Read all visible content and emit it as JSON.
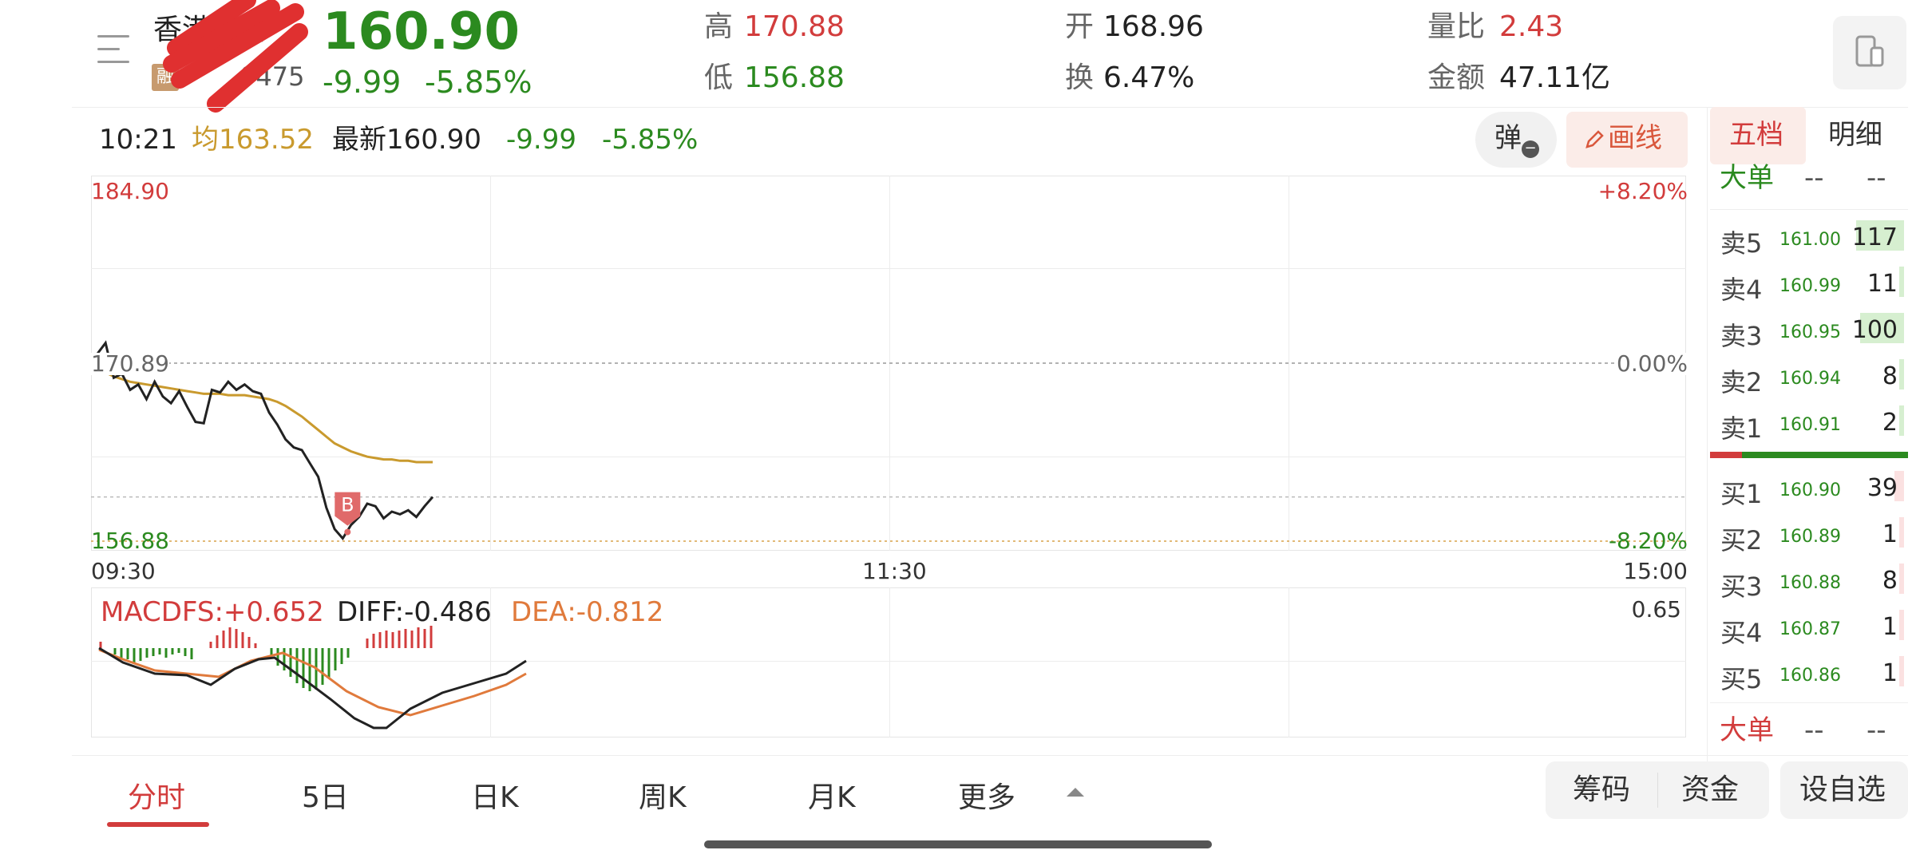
{
  "header": {
    "stock_name": "香港芯智",
    "stock_code": "0475",
    "rong_badge": "融",
    "price": "160.90",
    "change": "-9.99",
    "change_pct": "-5.85%",
    "high_label": "高",
    "high_value": "170.88",
    "low_label": "低",
    "low_value": "156.88",
    "open_label": "开",
    "open_value": "168.96",
    "turnover_label": "换",
    "turnover_value": "6.47%",
    "vol_ratio_label": "量比",
    "vol_ratio_value": "2.43",
    "amount_label": "金额",
    "amount_value": "47.11亿"
  },
  "infobar": {
    "time": "10:21",
    "avg_label": "均163.52",
    "latest_label": "最新160.90",
    "change": "-9.99",
    "change_pct": "-5.85%",
    "popup_button": "弹",
    "draw_button": "画线"
  },
  "chart": {
    "y_top": "184.90",
    "y_mid": "170.89",
    "y_bottom": "156.88",
    "pct_top": "+8.20%",
    "pct_mid": "0.00%",
    "pct_bottom": "-8.20%",
    "time_start": "09:30",
    "time_mid": "11:30",
    "time_end": "15:00",
    "marker": "B"
  },
  "chart_data": {
    "type": "line",
    "x_axis": [
      "09:30",
      "11:30",
      "15:00"
    ],
    "ylim": [
      156.88,
      184.9
    ],
    "prev_close": 170.89,
    "series": [
      {
        "name": "最新",
        "values": [
          171.6,
          172.4,
          169.8,
          170.1,
          168.9,
          169.3,
          168.2,
          169.5,
          168.4,
          167.9,
          168.8,
          167.6,
          166.5,
          166.4,
          168.9,
          168.7,
          169.5,
          168.9,
          169.3,
          168.8,
          168.6,
          167.2,
          166.3,
          165.2,
          164.6,
          164.4,
          163.4,
          162.4,
          160.1,
          158.5,
          157.8,
          158.8,
          159.4,
          160.4,
          160.2,
          159.3,
          159.8,
          159.6,
          159.9,
          159.4,
          160.2,
          160.9
        ]
      },
      {
        "name": "均",
        "values": [
          170.4,
          170.2,
          169.9,
          169.7,
          169.5,
          169.4,
          169.3,
          169.2,
          169.1,
          169.0,
          168.9,
          168.8,
          168.7,
          168.6,
          168.6,
          168.6,
          168.5,
          168.5,
          168.5,
          168.4,
          168.3,
          168.2,
          168.0,
          167.7,
          167.3,
          166.9,
          166.4,
          165.9,
          165.4,
          164.9,
          164.6,
          164.3,
          164.1,
          163.9,
          163.8,
          163.7,
          163.7,
          163.6,
          163.6,
          163.5,
          163.5,
          163.5
        ]
      }
    ],
    "macd": {
      "macdfs_label": "MACDFS:+0.652",
      "diff_label": "DIFF:-0.486",
      "dea_label": "DEA:-0.812",
      "scale_label": "0.65"
    }
  },
  "orderbook": {
    "tab_five": "五档",
    "tab_detail": "明细",
    "big_label": "大单",
    "placeholder": "--",
    "asks": [
      {
        "label": "卖5",
        "price": "161.00",
        "vol": "117",
        "bar": 0.6
      },
      {
        "label": "卖4",
        "price": "160.99",
        "vol": "11",
        "bar": 0.06
      },
      {
        "label": "卖3",
        "price": "160.95",
        "vol": "100",
        "bar": 0.55
      },
      {
        "label": "卖2",
        "price": "160.94",
        "vol": "8",
        "bar": 0.04
      },
      {
        "label": "卖1",
        "price": "160.91",
        "vol": "2",
        "bar": 0.02
      }
    ],
    "bids": [
      {
        "label": "买1",
        "price": "160.90",
        "vol": "39",
        "bar": 0.12
      },
      {
        "label": "买2",
        "price": "160.89",
        "vol": "1",
        "bar": 0.01
      },
      {
        "label": "买3",
        "price": "160.88",
        "vol": "8",
        "bar": 0.03
      },
      {
        "label": "买4",
        "price": "160.87",
        "vol": "1",
        "bar": 0.01
      },
      {
        "label": "买5",
        "price": "160.86",
        "vol": "1",
        "bar": 0.01
      }
    ]
  },
  "tabs": [
    "分时",
    "5日",
    "日K",
    "周K",
    "月K",
    "更多"
  ],
  "bottom_buttons": {
    "chips": "筹码",
    "funds": "资金",
    "watchlist": "设自选"
  },
  "colors": {
    "up": "#d23c3c",
    "down": "#2b8a1f",
    "avg": "#c99a2e",
    "price_line": "#222222"
  }
}
